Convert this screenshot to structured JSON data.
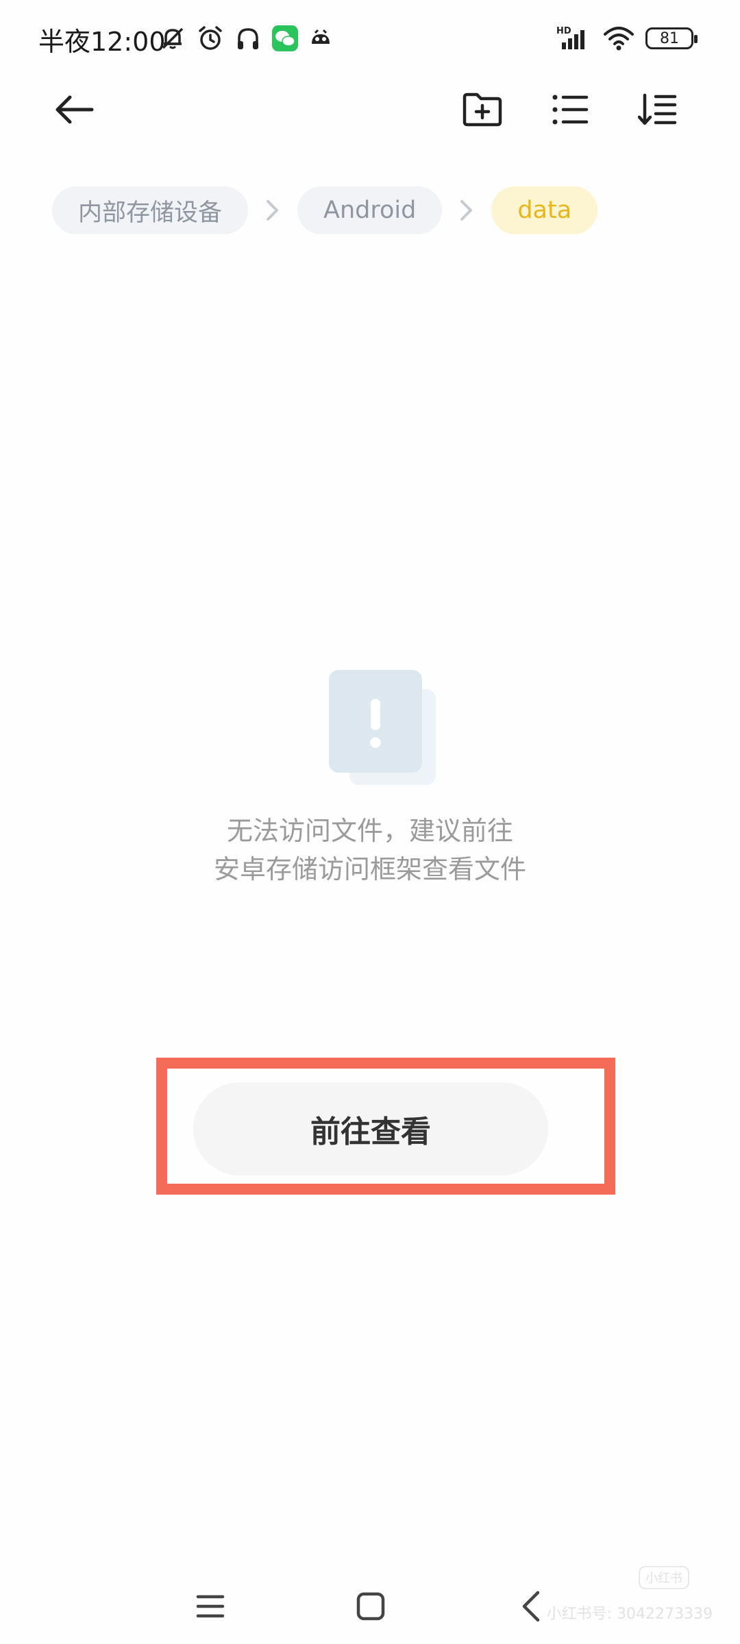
{
  "status_bar": {
    "time": "半夜12:00",
    "battery": "81",
    "network": "HD",
    "icons_left": [
      "mute-bell-icon",
      "alarm-icon",
      "headphones-icon",
      "wechat-icon",
      "app-notification-icon"
    ],
    "icons_right": [
      "signal-icon",
      "wifi-icon",
      "battery-icon"
    ]
  },
  "toolbar": {
    "back_icon": "arrow-left-icon",
    "actions": [
      "new-folder-icon",
      "list-view-icon",
      "sort-icon"
    ]
  },
  "breadcrumbs": [
    {
      "label": "内部存储设备",
      "active": false
    },
    {
      "label": "Android",
      "active": false
    },
    {
      "label": "data",
      "active": true
    }
  ],
  "empty_state": {
    "icon": "warning-document-icon",
    "line1": "无法访问文件，建议前往",
    "line2": "安卓存储访问框架查看文件"
  },
  "cta": {
    "label": "前往查看",
    "highlight_color": "#f46c58"
  },
  "nav_bar": {
    "buttons": [
      "menu-icon",
      "home-icon",
      "back-icon"
    ]
  },
  "watermark": {
    "logo": "小红书",
    "text": "小红书号: 3042273339"
  },
  "colors": {
    "accent_active_bg": "#fdf5d2",
    "accent_active_text": "#e7b71a",
    "crumb_bg": "#f1f3f6",
    "crumb_text": "#8f96a2"
  }
}
